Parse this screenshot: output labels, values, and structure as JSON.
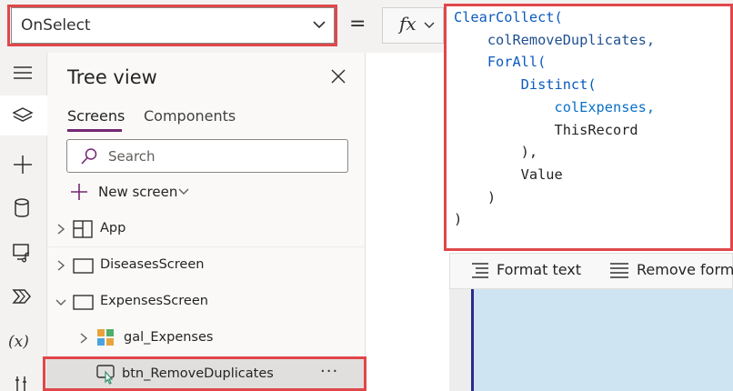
{
  "property_selector": {
    "value": "OnSelect"
  },
  "formula_bar": {
    "equals": "=",
    "fx_label": "fx",
    "code_lines": [
      "ClearCollect(",
      "    colRemoveDuplicates,",
      "    ForAll(",
      "        Distinct(",
      "            colExpenses,",
      "            ThisRecord",
      "        ),",
      "        Value",
      "    )",
      ")"
    ]
  },
  "toolbar": {
    "format_text": "Format text",
    "remove_formatting": "Remove forma"
  },
  "left_rail": {
    "icons": [
      "hamburger-icon",
      "layers-icon",
      "plus-icon",
      "database-icon",
      "media-icon",
      "power-automate-icon",
      "variables-icon",
      "tools-icon"
    ],
    "variables_label": "(x)"
  },
  "tree_view": {
    "title": "Tree view",
    "tabs": {
      "screens": "Screens",
      "components": "Components"
    },
    "search_placeholder": "Search",
    "new_screen": "New screen",
    "items": [
      {
        "label": "App"
      },
      {
        "label": "DiseasesScreen"
      },
      {
        "label": "ExpensesScreen"
      },
      {
        "label": "gal_Expenses"
      },
      {
        "label": "btn_RemoveDuplicates"
      }
    ],
    "more_label": "···"
  },
  "colors": {
    "highlight": "#e0474a",
    "accent": "#742774",
    "code_function": "#0b5bbf",
    "code_collection": "#0a70c8",
    "screen_preview": "#cfe4f2"
  }
}
